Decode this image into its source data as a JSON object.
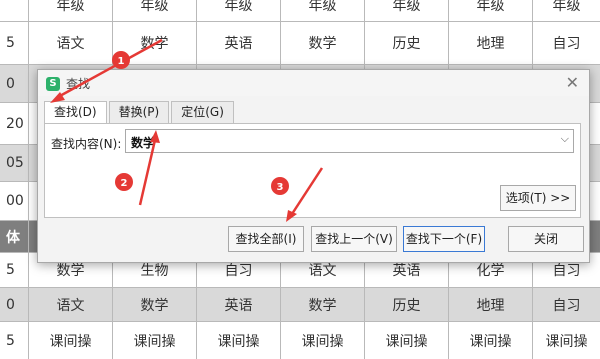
{
  "sheet": {
    "rows": [
      {
        "cells": [
          "",
          "年级",
          "年级",
          "年级",
          "年级",
          "年级",
          "年级",
          "年级"
        ]
      },
      {
        "cells": [
          "5",
          "语文",
          "数学",
          "英语",
          "数学",
          "历史",
          "地理",
          "自习"
        ]
      },
      {
        "cells": [
          "0",
          "",
          "",
          "",
          "",
          "",
          "",
          ""
        ]
      },
      {
        "cells": [
          "20",
          "",
          "",
          "",
          "",
          "",
          "",
          ""
        ]
      },
      {
        "cells": [
          "05",
          "",
          "",
          "",
          "",
          "",
          "",
          ""
        ]
      },
      {
        "cells": [
          "00",
          "",
          "",
          "",
          "",
          "",
          "",
          ""
        ]
      },
      {
        "cells": [
          "体",
          "",
          "",
          "",
          "",
          "",
          "",
          ""
        ]
      },
      {
        "cells": [
          "5",
          "数学",
          "生物",
          "自习",
          "语文",
          "英语",
          "化学",
          "自习"
        ]
      },
      {
        "cells": [
          "0",
          "语文",
          "数学",
          "英语",
          "数学",
          "历史",
          "地理",
          "自习"
        ]
      },
      {
        "cells": [
          "5",
          "课间操",
          "课间操",
          "课间操",
          "课间操",
          "课间操",
          "课间操",
          "课间操"
        ]
      }
    ]
  },
  "dialog": {
    "title": "查找",
    "app_icon": "S",
    "close_glyph": "✕",
    "tabs": [
      "查找(D)",
      "替换(P)",
      "定位(G)"
    ],
    "find_label": "查找内容(N):",
    "find_value": "数学",
    "dropdown_glyph": "⌵",
    "options_button": "选项(T) >>",
    "buttons": {
      "find_all": "查找全部(I)",
      "find_prev": "查找上一个(V)",
      "find_next": "查找下一个(F)",
      "close": "关闭"
    }
  },
  "annotations": {
    "color": "#e53935",
    "badges": [
      "1",
      "2",
      "3"
    ]
  }
}
